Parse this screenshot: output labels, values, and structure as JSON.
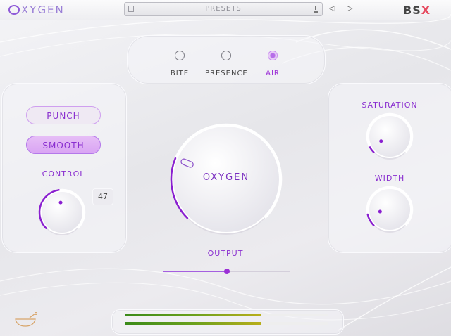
{
  "header": {
    "logo_text": "XYGEN",
    "preset_label": "PRESETS",
    "brand": "BS",
    "brand_mark": "X"
  },
  "modes": [
    {
      "label": "BITE",
      "active": false
    },
    {
      "label": "PRESENCE",
      "active": false
    },
    {
      "label": "AIR",
      "active": true
    }
  ],
  "left_panel": {
    "punch_label": "PUNCH",
    "smooth_label": "SMOOTH",
    "control_label": "CONTROL",
    "control_value": "47"
  },
  "main": {
    "knob_label": "OXYGEN",
    "output_label": "OUTPUT",
    "output_level": 0.5
  },
  "right_panel": {
    "saturation_label": "SATURATION",
    "width_label": "WIDTH"
  },
  "knobs": {
    "control": 0.47,
    "oxygen": 0.25,
    "saturation": 0.06,
    "width": 0.12
  },
  "meters": {
    "left": 0.67,
    "right": 0.67
  },
  "colors": {
    "accent": "#9b2fd6",
    "arc": "#8a1fd0"
  },
  "icons": {
    "preset_icon": "folder-icon",
    "save_icon": "download-icon",
    "prev_icon": "triangle-left-icon",
    "next_icon": "triangle-right-icon",
    "footer_icon": "bowl-icon"
  }
}
